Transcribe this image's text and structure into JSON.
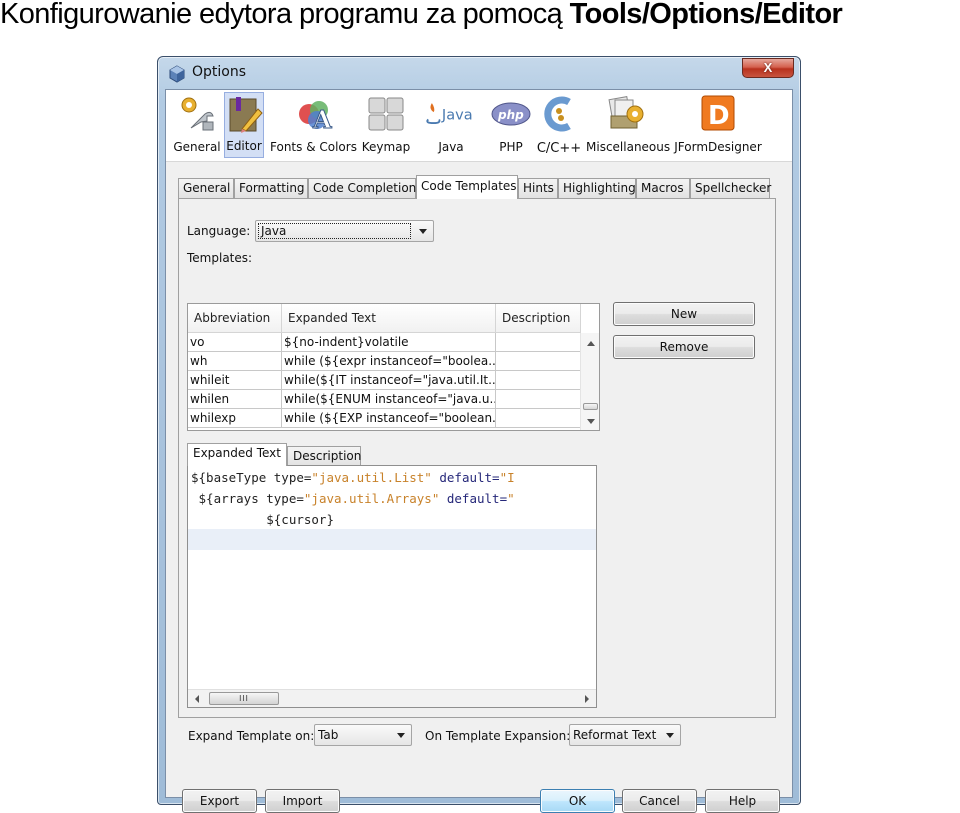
{
  "slide": {
    "title_normal": "Konfigurowanie edytora programu za pomocą ",
    "title_bold": "Tools/Options/Editor"
  },
  "window": {
    "title": "Options",
    "close_label": "X"
  },
  "categories": [
    {
      "label": "General",
      "icon": "general-settings-icon",
      "selected": false
    },
    {
      "label": "Editor",
      "icon": "editor-icon",
      "selected": true
    },
    {
      "label": "Fonts & Colors",
      "icon": "fonts-colors-icon",
      "selected": false
    },
    {
      "label": "Keymap",
      "icon": "keymap-icon",
      "selected": false
    },
    {
      "label": "Java",
      "icon": "java-icon",
      "selected": false
    },
    {
      "label": "PHP",
      "icon": "php-icon",
      "selected": false
    },
    {
      "label": "C/C++",
      "icon": "cpp-icon",
      "selected": false
    },
    {
      "label": "Miscellaneous",
      "icon": "miscellaneous-icon",
      "selected": false
    },
    {
      "label": "JFormDesigner",
      "icon": "jformdesigner-icon",
      "selected": false
    }
  ],
  "tabs": [
    {
      "label": "General",
      "active": false
    },
    {
      "label": "Formatting",
      "active": false
    },
    {
      "label": "Code Completion",
      "active": false
    },
    {
      "label": "Code Templates",
      "active": true
    },
    {
      "label": "Hints",
      "active": false
    },
    {
      "label": "Highlighting",
      "active": false
    },
    {
      "label": "Macros",
      "active": false
    },
    {
      "label": "Spellchecker",
      "active": false
    }
  ],
  "code_templates": {
    "language_label": "Language:",
    "language_value": "Java",
    "templates_label": "Templates:",
    "table": {
      "columns": [
        "Abbreviation",
        "Expanded Text",
        "Description"
      ],
      "rows": [
        [
          "vo",
          "${no-indent}volatile",
          ""
        ],
        [
          "wh",
          "while (${expr instanceof=\"boolea...",
          ""
        ],
        [
          "whileit",
          "while(${IT instanceof=\"java.util.It...",
          ""
        ],
        [
          "whilen",
          "while(${ENUM instanceof=\"java.u...",
          ""
        ],
        [
          "whilexp",
          "while (${EXP instanceof=\"boolean...",
          ""
        ]
      ]
    },
    "new_button": "New",
    "remove_button": "Remove",
    "subtabs": [
      {
        "label": "Expanded Text",
        "active": true
      },
      {
        "label": "Description",
        "active": false
      }
    ],
    "code_lines": [
      [
        {
          "t": "${baseType type=",
          "c": ""
        },
        {
          "t": "\"java.util.List\"",
          "c": "str"
        },
        {
          "t": " default=",
          "c": "kw"
        },
        {
          "t": "\"I",
          "c": "str"
        }
      ],
      [
        {
          "t": " ${arrays type=",
          "c": ""
        },
        {
          "t": "\"java.util.Arrays\"",
          "c": "str"
        },
        {
          "t": " default=",
          "c": "kw"
        },
        {
          "t": "\"",
          "c": "str"
        }
      ],
      [
        {
          "t": "          ${cursor}",
          "c": ""
        }
      ]
    ],
    "hscroll_thumb": "III",
    "expand_on_label": "Expand Template on:",
    "expand_on_value": "Tab",
    "on_expansion_label": "On Template Expansion:",
    "on_expansion_value": "Reformat Text"
  },
  "footer": {
    "export": "Export",
    "import": "Import",
    "ok": "OK",
    "cancel": "Cancel",
    "help": "Help"
  }
}
